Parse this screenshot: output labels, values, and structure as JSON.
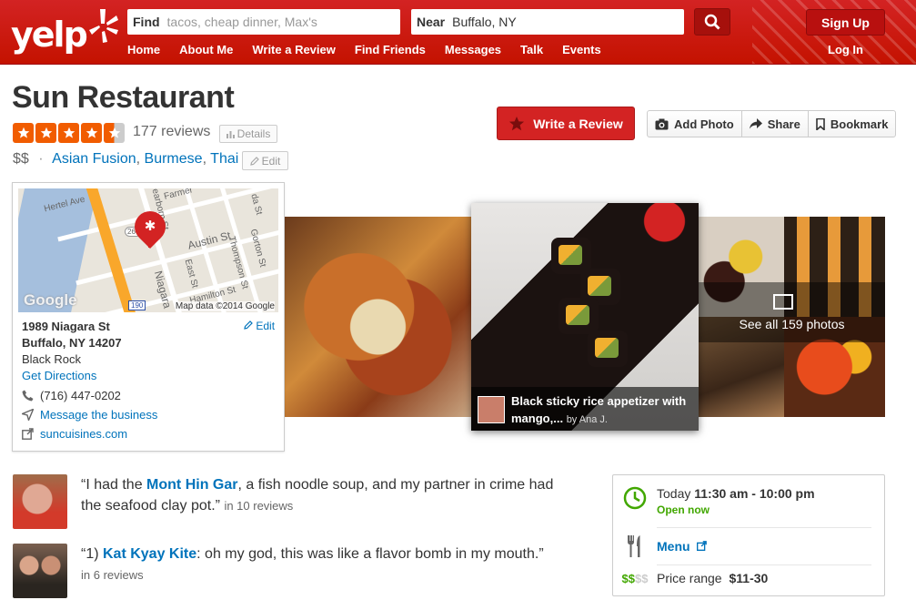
{
  "header": {
    "logo": "yelp",
    "find_label": "Find",
    "find_placeholder": "tacos, cheap dinner, Max's",
    "near_label": "Near",
    "near_value": "Buffalo, NY",
    "nav": [
      "Home",
      "About Me",
      "Write a Review",
      "Find Friends",
      "Messages",
      "Talk",
      "Events"
    ],
    "signup_label": "Sign Up",
    "login_label": "Log In",
    "accent_color": "#d32323"
  },
  "business": {
    "name": "Sun Restaurant",
    "rating": 4.5,
    "review_count": "177 reviews",
    "details_label": "Details",
    "price": "$$",
    "separator": "·",
    "categories": [
      "Asian Fusion",
      "Burmese",
      "Thai"
    ],
    "edit_label": "Edit"
  },
  "actions": {
    "write_review": "Write a Review",
    "add_photo": "Add Photo",
    "share": "Share",
    "bookmark": "Bookmark"
  },
  "map_card": {
    "map_labels": [
      "Hertel Ave",
      "Austin St",
      "Gorton St",
      "Thompson St",
      "East St",
      "Hamilton St",
      "Niagara",
      "Farmer",
      "Dearborn St",
      "da St",
      "266",
      "190"
    ],
    "map_credit": "Map data ©2014 Google",
    "google_mark": "Google",
    "address_line1": "1989 Niagara St",
    "address_line2": "Buffalo, NY 14207",
    "neighborhood": "Black Rock",
    "edit_label": "Edit",
    "get_directions": "Get Directions",
    "phone": "(716) 447-0202",
    "message_business": "Message the business",
    "website": "suncuisines.com"
  },
  "photos": {
    "caption_title": "Black sticky rice appetizer with mango,...",
    "caption_by": "by Ana J.",
    "see_all": "See all 159 photos"
  },
  "snippets": [
    {
      "quote_open": "“I had the ",
      "highlight": "Mont Hin Gar",
      "quote_rest": ", a fish noodle soup, and my partner in crime had the seafood clay pot.”",
      "meta": "in 10 reviews"
    },
    {
      "quote_open": "“1) ",
      "highlight": "Kat Kyay Kite",
      "quote_rest": ": oh my god, this was like a flavor bomb in my mouth.”",
      "meta": "in 6 reviews"
    }
  ],
  "hours": {
    "today_label": "Today",
    "today_hours": "11:30 am - 10:00 pm",
    "open_status": "Open now",
    "menu_label": "Menu",
    "price_symbols_active": "$$",
    "price_symbols_inactive": "$$",
    "price_range_label": "Price range",
    "price_range_value": "$11-30",
    "open_color": "#41a700"
  }
}
